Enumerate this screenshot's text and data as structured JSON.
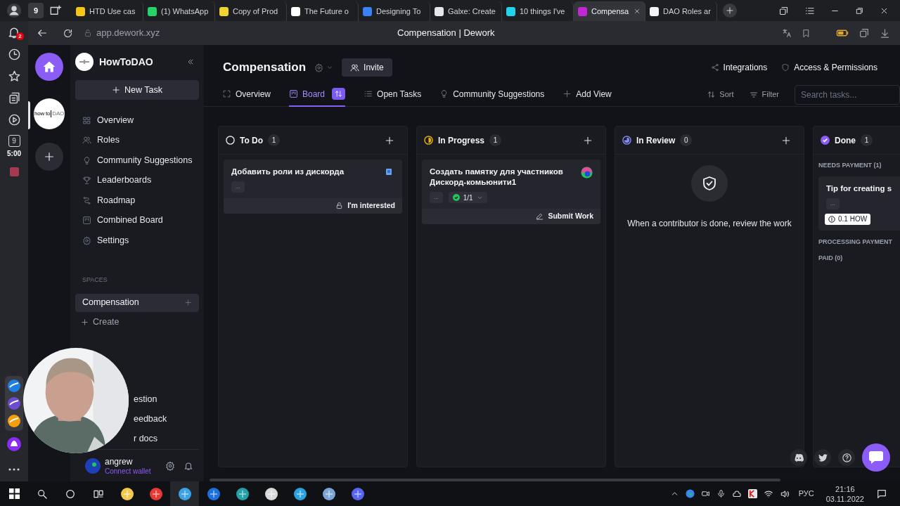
{
  "browser": {
    "tab_count": "9",
    "tabs": [
      {
        "title": "HTD Use cas",
        "color": "#f5c518",
        "selected": false
      },
      {
        "title": "(1) WhatsApp",
        "color": "#25d366",
        "selected": false
      },
      {
        "title": "Copy of Prod",
        "color": "#f2d22e",
        "selected": false
      },
      {
        "title": "The Future o",
        "color": "#ffffff",
        "selected": false
      },
      {
        "title": "Designing To",
        "color": "#3b82f6",
        "selected": false
      },
      {
        "title": "Galxe: Create",
        "color": "#e5e7eb",
        "selected": false
      },
      {
        "title": "10 things I've",
        "color": "#22d3ee",
        "selected": false
      },
      {
        "title": "Compensa",
        "color": "#c026d3",
        "selected": true
      },
      {
        "title": "DAO Roles ar",
        "color": "#f3f4f6",
        "selected": false
      }
    ],
    "address": "app.dework.xyz",
    "page_title": "Compensation | Dework"
  },
  "browser_sidebar": {
    "notification_count": "2",
    "counter": "9",
    "timer": "5:00"
  },
  "workspace_rail": {
    "logo_text": [
      "how to",
      "DAO"
    ]
  },
  "sidebar": {
    "org_name": "HowToDAO",
    "new_task": "New Task",
    "items": [
      {
        "label": "Overview"
      },
      {
        "label": "Roles"
      },
      {
        "label": "Community Suggestions"
      },
      {
        "label": "Leaderboards"
      },
      {
        "label": "Roadmap"
      },
      {
        "label": "Combined Board"
      },
      {
        "label": "Settings"
      }
    ],
    "spaces_heading": "SPACES",
    "spaces": [
      {
        "label": "Compensation",
        "selected": true
      }
    ],
    "create": "Create",
    "footer_links": [
      "estion",
      "eedback",
      "r docs"
    ],
    "user": {
      "name": "angrew",
      "wallet": "Connect wallet"
    }
  },
  "header": {
    "title": "Compensation",
    "invite": "Invite",
    "actions": [
      {
        "label": "Integrations"
      },
      {
        "label": "Access & Permissions"
      }
    ]
  },
  "views": [
    {
      "label": "Overview",
      "selected": false
    },
    {
      "label": "Board",
      "selected": true
    },
    {
      "label": "Open Tasks",
      "selected": false
    },
    {
      "label": "Community Suggestions",
      "selected": false
    },
    {
      "label": "Add View",
      "selected": false
    }
  ],
  "toolbar": {
    "sort": "Sort",
    "filter": "Filter",
    "search_placeholder": "Search tasks..."
  },
  "columns": [
    {
      "title": "To Do",
      "count": "1",
      "kind": "todo",
      "cards": [
        {
          "title": "Добавить роли из дискорда",
          "tag": "...",
          "kind": "open",
          "action": {
            "label": "I'm interested"
          }
        }
      ]
    },
    {
      "title": "In Progress",
      "count": "1",
      "kind": "progress",
      "cards": [
        {
          "title": "Создать памятку для участников Дискорд-комьюнити1",
          "tag": "...",
          "progress": "1/1",
          "kind": "assigned",
          "action": {
            "label": "Submit Work"
          }
        }
      ]
    },
    {
      "title": "In Review",
      "count": "0",
      "kind": "review",
      "empty_text": "When a contributor is done, review the work"
    },
    {
      "title": "Done",
      "count": "1",
      "kind": "done",
      "groups": [
        {
          "title": "NEEDS PAYMENT (1)",
          "cards": [
            {
              "title": "Tip for creating s",
              "tag": "...",
              "reward": "0.1 HOW"
            }
          ]
        },
        {
          "title": "PROCESSING PAYMENT"
        },
        {
          "title": "PAID (0)"
        }
      ]
    }
  ],
  "taskbar": {
    "language": "РУС",
    "time": "21:16",
    "date": "03.11.2022"
  }
}
